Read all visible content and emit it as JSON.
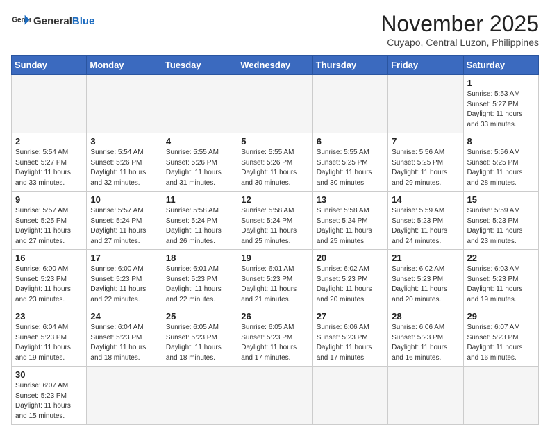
{
  "logo": {
    "text_general": "General",
    "text_blue": "Blue"
  },
  "header": {
    "month_year": "November 2025",
    "location": "Cuyapo, Central Luzon, Philippines"
  },
  "weekdays": [
    "Sunday",
    "Monday",
    "Tuesday",
    "Wednesday",
    "Thursday",
    "Friday",
    "Saturday"
  ],
  "weeks": [
    [
      {
        "day": "",
        "info": ""
      },
      {
        "day": "",
        "info": ""
      },
      {
        "day": "",
        "info": ""
      },
      {
        "day": "",
        "info": ""
      },
      {
        "day": "",
        "info": ""
      },
      {
        "day": "",
        "info": ""
      },
      {
        "day": "1",
        "info": "Sunrise: 5:53 AM\nSunset: 5:27 PM\nDaylight: 11 hours\nand 33 minutes."
      }
    ],
    [
      {
        "day": "2",
        "info": "Sunrise: 5:54 AM\nSunset: 5:27 PM\nDaylight: 11 hours\nand 33 minutes."
      },
      {
        "day": "3",
        "info": "Sunrise: 5:54 AM\nSunset: 5:26 PM\nDaylight: 11 hours\nand 32 minutes."
      },
      {
        "day": "4",
        "info": "Sunrise: 5:55 AM\nSunset: 5:26 PM\nDaylight: 11 hours\nand 31 minutes."
      },
      {
        "day": "5",
        "info": "Sunrise: 5:55 AM\nSunset: 5:26 PM\nDaylight: 11 hours\nand 30 minutes."
      },
      {
        "day": "6",
        "info": "Sunrise: 5:55 AM\nSunset: 5:25 PM\nDaylight: 11 hours\nand 30 minutes."
      },
      {
        "day": "7",
        "info": "Sunrise: 5:56 AM\nSunset: 5:25 PM\nDaylight: 11 hours\nand 29 minutes."
      },
      {
        "day": "8",
        "info": "Sunrise: 5:56 AM\nSunset: 5:25 PM\nDaylight: 11 hours\nand 28 minutes."
      }
    ],
    [
      {
        "day": "9",
        "info": "Sunrise: 5:57 AM\nSunset: 5:25 PM\nDaylight: 11 hours\nand 27 minutes."
      },
      {
        "day": "10",
        "info": "Sunrise: 5:57 AM\nSunset: 5:24 PM\nDaylight: 11 hours\nand 27 minutes."
      },
      {
        "day": "11",
        "info": "Sunrise: 5:58 AM\nSunset: 5:24 PM\nDaylight: 11 hours\nand 26 minutes."
      },
      {
        "day": "12",
        "info": "Sunrise: 5:58 AM\nSunset: 5:24 PM\nDaylight: 11 hours\nand 25 minutes."
      },
      {
        "day": "13",
        "info": "Sunrise: 5:58 AM\nSunset: 5:24 PM\nDaylight: 11 hours\nand 25 minutes."
      },
      {
        "day": "14",
        "info": "Sunrise: 5:59 AM\nSunset: 5:23 PM\nDaylight: 11 hours\nand 24 minutes."
      },
      {
        "day": "15",
        "info": "Sunrise: 5:59 AM\nSunset: 5:23 PM\nDaylight: 11 hours\nand 23 minutes."
      }
    ],
    [
      {
        "day": "16",
        "info": "Sunrise: 6:00 AM\nSunset: 5:23 PM\nDaylight: 11 hours\nand 23 minutes."
      },
      {
        "day": "17",
        "info": "Sunrise: 6:00 AM\nSunset: 5:23 PM\nDaylight: 11 hours\nand 22 minutes."
      },
      {
        "day": "18",
        "info": "Sunrise: 6:01 AM\nSunset: 5:23 PM\nDaylight: 11 hours\nand 22 minutes."
      },
      {
        "day": "19",
        "info": "Sunrise: 6:01 AM\nSunset: 5:23 PM\nDaylight: 11 hours\nand 21 minutes."
      },
      {
        "day": "20",
        "info": "Sunrise: 6:02 AM\nSunset: 5:23 PM\nDaylight: 11 hours\nand 20 minutes."
      },
      {
        "day": "21",
        "info": "Sunrise: 6:02 AM\nSunset: 5:23 PM\nDaylight: 11 hours\nand 20 minutes."
      },
      {
        "day": "22",
        "info": "Sunrise: 6:03 AM\nSunset: 5:23 PM\nDaylight: 11 hours\nand 19 minutes."
      }
    ],
    [
      {
        "day": "23",
        "info": "Sunrise: 6:04 AM\nSunset: 5:23 PM\nDaylight: 11 hours\nand 19 minutes."
      },
      {
        "day": "24",
        "info": "Sunrise: 6:04 AM\nSunset: 5:23 PM\nDaylight: 11 hours\nand 18 minutes."
      },
      {
        "day": "25",
        "info": "Sunrise: 6:05 AM\nSunset: 5:23 PM\nDaylight: 11 hours\nand 18 minutes."
      },
      {
        "day": "26",
        "info": "Sunrise: 6:05 AM\nSunset: 5:23 PM\nDaylight: 11 hours\nand 17 minutes."
      },
      {
        "day": "27",
        "info": "Sunrise: 6:06 AM\nSunset: 5:23 PM\nDaylight: 11 hours\nand 17 minutes."
      },
      {
        "day": "28",
        "info": "Sunrise: 6:06 AM\nSunset: 5:23 PM\nDaylight: 11 hours\nand 16 minutes."
      },
      {
        "day": "29",
        "info": "Sunrise: 6:07 AM\nSunset: 5:23 PM\nDaylight: 11 hours\nand 16 minutes."
      }
    ],
    [
      {
        "day": "30",
        "info": "Sunrise: 6:07 AM\nSunset: 5:23 PM\nDaylight: 11 hours\nand 15 minutes."
      },
      {
        "day": "",
        "info": ""
      },
      {
        "day": "",
        "info": ""
      },
      {
        "day": "",
        "info": ""
      },
      {
        "day": "",
        "info": ""
      },
      {
        "day": "",
        "info": ""
      },
      {
        "day": "",
        "info": ""
      }
    ]
  ]
}
